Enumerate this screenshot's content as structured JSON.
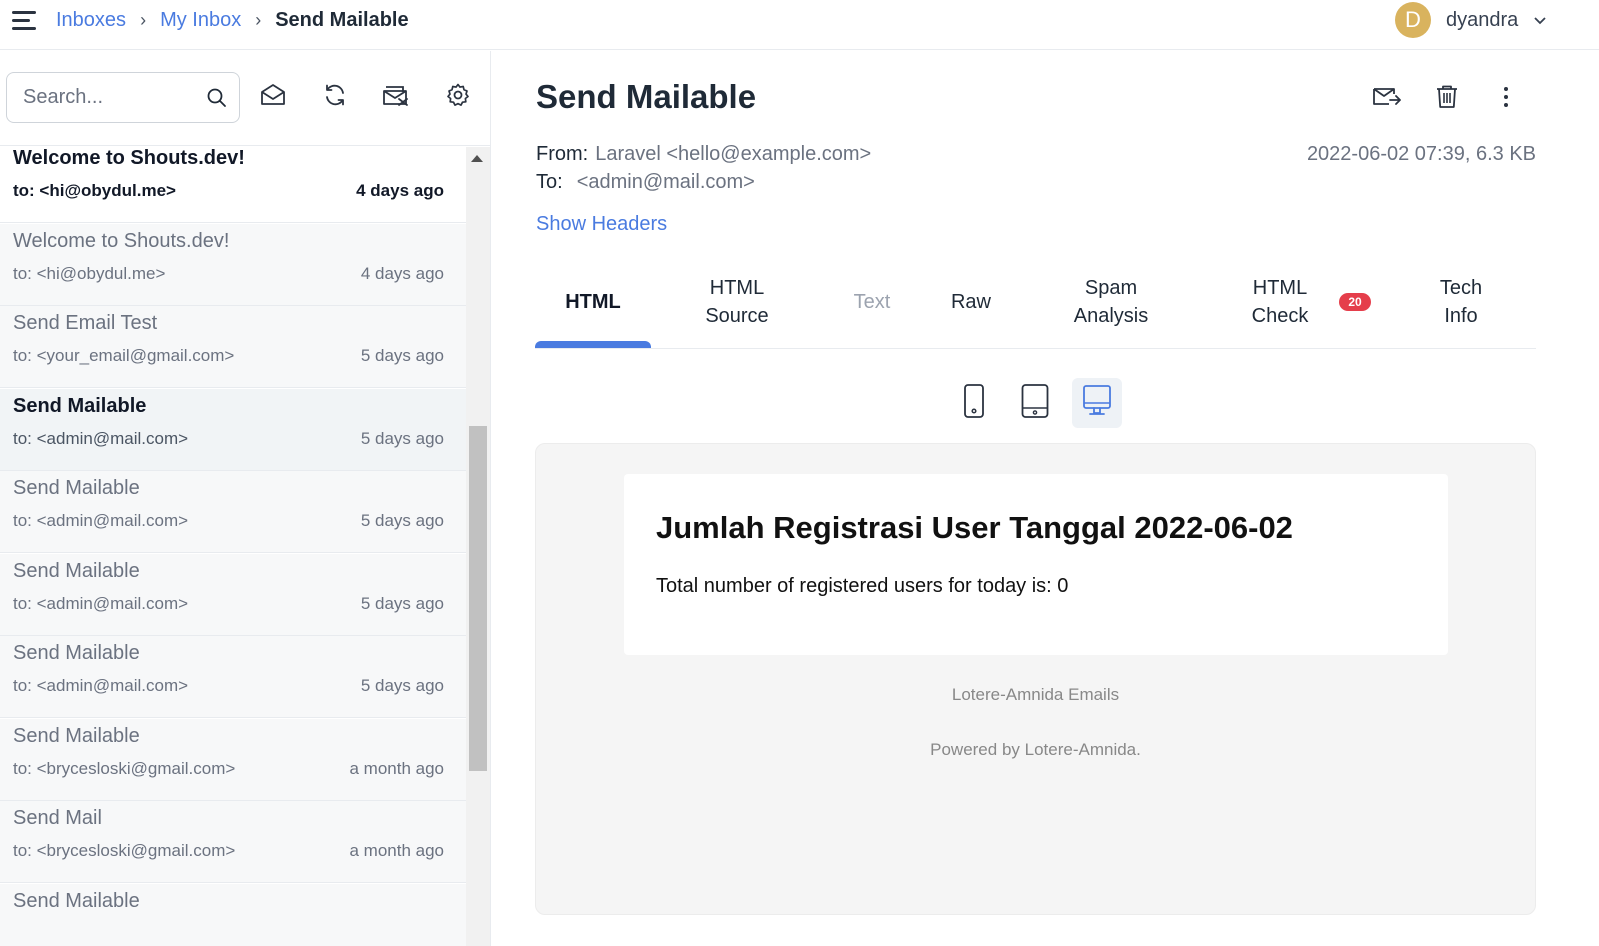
{
  "breadcrumb": {
    "inboxes": "Inboxes",
    "my_inbox": "My Inbox",
    "current": "Send Mailable",
    "separator": "›"
  },
  "user": {
    "initial": "D",
    "name": "dyandra",
    "avatar_color": "#d9b35e"
  },
  "sidebar": {
    "search_placeholder": "Search...",
    "messages": [
      {
        "subject": "Welcome to Shouts.dev!",
        "to": "to: <hi@obydul.me>",
        "time": "4 days ago",
        "state": "unread"
      },
      {
        "subject": "Welcome to Shouts.dev!",
        "to": "to: <hi@obydul.me>",
        "time": "4 days ago",
        "state": "read"
      },
      {
        "subject": "Send Email Test",
        "to": "to: <your_email@gmail.com>",
        "time": "5 days ago",
        "state": "read"
      },
      {
        "subject": "Send Mailable",
        "to": "to: <admin@mail.com>",
        "time": "5 days ago",
        "state": "active"
      },
      {
        "subject": "Send Mailable",
        "to": "to: <admin@mail.com>",
        "time": "5 days ago",
        "state": "read"
      },
      {
        "subject": "Send Mailable",
        "to": "to: <admin@mail.com>",
        "time": "5 days ago",
        "state": "read"
      },
      {
        "subject": "Send Mailable",
        "to": "to: <admin@mail.com>",
        "time": "5 days ago",
        "state": "read"
      },
      {
        "subject": "Send Mailable",
        "to": "to: <brycesloski@gmail.com>",
        "time": "a month ago",
        "state": "read"
      },
      {
        "subject": "Send Mail",
        "to": "to: <brycesloski@gmail.com>",
        "time": "a month ago",
        "state": "read"
      },
      {
        "subject": "Send Mailable",
        "to": "",
        "time": "",
        "state": "read"
      }
    ]
  },
  "message": {
    "subject": "Send Mailable",
    "from_label": "From:",
    "from_value": "Laravel <hello@example.com>",
    "to_label": "To:",
    "to_value": "<admin@mail.com>",
    "date_size": "2022-06-02 07:39, 6.3 KB",
    "show_headers": "Show Headers"
  },
  "tabs": [
    {
      "label_line1": "HTML",
      "label_line2": "",
      "state": "active"
    },
    {
      "label_line1": "HTML",
      "label_line2": "Source",
      "state": "normal"
    },
    {
      "label_line1": "Text",
      "label_line2": "",
      "state": "disabled"
    },
    {
      "label_line1": "Raw",
      "label_line2": "",
      "state": "normal"
    },
    {
      "label_line1": "Spam",
      "label_line2": "Analysis",
      "state": "normal"
    },
    {
      "label_line1": "HTML",
      "label_line2": "Check",
      "state": "normal"
    },
    {
      "label_line1": "Tech",
      "label_line2": "Info",
      "state": "normal"
    }
  ],
  "html_check_badge": "20",
  "preview_devices": [
    {
      "icon": "phone-icon",
      "active": false
    },
    {
      "icon": "tablet-icon",
      "active": false
    },
    {
      "icon": "desktop-icon",
      "active": true
    }
  ],
  "email": {
    "heading": "Jumlah Registrasi User Tanggal 2022-06-02",
    "body": "Total number of registered users for today is: 0",
    "footer_line1": "Lotere-Amnida Emails",
    "footer_line2": "Powered by Lotere-Amnida."
  },
  "colors": {
    "accent": "#4a7be0",
    "badge": "#e53e4b",
    "text": "#1f2a37",
    "muted": "#6b7280"
  }
}
